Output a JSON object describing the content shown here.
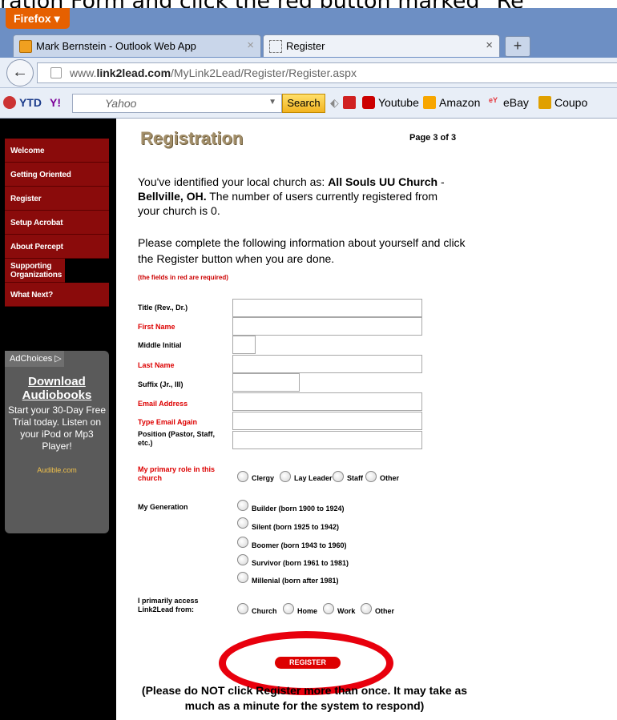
{
  "caption": "ration Form and click the red button marked \"Re",
  "browser": {
    "app_button": "Firefox",
    "tabs": [
      {
        "label": "Mark Bernstein - Outlook Web App",
        "close": "×"
      },
      {
        "label": "Register",
        "close": "×"
      }
    ],
    "new_tab": "+",
    "url_prefix": "www.",
    "url_domain": "link2lead.com",
    "url_path": "/MyLink2Lead/Register/Register.aspx",
    "toolbar": {
      "ytd": "YTD",
      "yahoo_logo": "Y!",
      "search_placeholder": "Yahoo",
      "search_button": "Search",
      "bookmarks": [
        "Youtube",
        "Amazon",
        "eBay",
        "Coupo"
      ]
    }
  },
  "sidebar": {
    "items": [
      {
        "label": "Welcome"
      },
      {
        "label": "Getting Oriented"
      },
      {
        "label": "Register"
      },
      {
        "label": "Setup Acrobat"
      },
      {
        "label": "About Percept"
      },
      {
        "label": "Supporting Organizations"
      },
      {
        "label": "What Next?"
      }
    ],
    "ad": {
      "choices": "AdChoices",
      "link": "Download Audiobooks",
      "text": "Start your 30-Day Free Trial today. Listen on your iPod or Mp3 Player!",
      "source": "Audible.com"
    }
  },
  "form": {
    "title": "Registration",
    "page": "Page 3 of 3",
    "intro_a": "You've identified your local church as: ",
    "church": "All Souls UU Church",
    "intro_dash": " - ",
    "city": "Bellville, OH.",
    "intro_b": " The number of users currently registered from your church is 0.",
    "instructions": "Please complete the following information about yourself and click the Register button when you are done.",
    "required_note": "(the fields in red are required)",
    "fields": [
      {
        "label": "Title (Rev., Dr.)",
        "value": ""
      },
      {
        "label": "First Name",
        "value": ""
      },
      {
        "label": "Middle Initial",
        "value": ""
      },
      {
        "label": "Last Name",
        "value": ""
      },
      {
        "label": "Suffix (Jr., III)",
        "value": ""
      },
      {
        "label": "Email Address",
        "value": ""
      },
      {
        "label": "Type Email Again",
        "value": ""
      },
      {
        "label": "Position (Pastor, Staff, etc.)",
        "value": ""
      }
    ],
    "role": {
      "label": "My primary role in this church",
      "options": [
        "Clergy",
        "Lay Leader",
        "Staff",
        "Other"
      ]
    },
    "generation": {
      "label": "My Generation",
      "options": [
        "Builder (born 1900 to 1924)",
        "Silent (born 1925 to 1942)",
        "Boomer (born 1943 to 1960)",
        "Survivor (born 1961 to 1981)",
        "Millenial (born after 1981)"
      ]
    },
    "access": {
      "label": "I primarily access Link2Lead from:",
      "options": [
        "Church",
        "Home",
        "Work",
        "Other"
      ]
    },
    "register_button": "REGISTER",
    "note": "(Please do NOT click Register more than once. It may take as much as a minute for the system to respond)"
  },
  "colors": {
    "nav_red": "#8a0b0b",
    "required_red": "#d00",
    "highlight_circle": "#e8000d",
    "firefox_orange": "#e66000"
  }
}
